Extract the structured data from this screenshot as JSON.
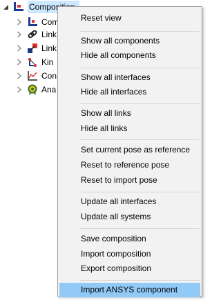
{
  "tree": {
    "root": {
      "label": "Composition",
      "icon": "composition-icon",
      "expanded": true
    },
    "children": [
      {
        "label": "Com",
        "icon": "components-icon"
      },
      {
        "label": "Link",
        "icon": "links-icon"
      },
      {
        "label": "Link",
        "icon": "interfaces-link-icon"
      },
      {
        "label": "Kin",
        "icon": "kinematics-icon"
      },
      {
        "label": "Con",
        "icon": "chart-icon"
      },
      {
        "label": "Ana",
        "icon": "analysis-icon"
      }
    ]
  },
  "context_menu": {
    "groups": [
      [
        {
          "label": "Reset view"
        }
      ],
      [
        {
          "label": "Show all components"
        },
        {
          "label": "Hide all components"
        }
      ],
      [
        {
          "label": "Show all interfaces"
        },
        {
          "label": "Hide all interfaces"
        }
      ],
      [
        {
          "label": "Show all links"
        },
        {
          "label": "Hide all links"
        }
      ],
      [
        {
          "label": "Set current pose as reference"
        },
        {
          "label": "Reset to reference pose"
        },
        {
          "label": "Reset to import pose"
        }
      ],
      [
        {
          "label": "Update all interfaces"
        },
        {
          "label": "Update all systems"
        }
      ],
      [
        {
          "label": "Save composition"
        },
        {
          "label": "Import composition"
        },
        {
          "label": "Export composition"
        }
      ],
      [
        {
          "label": "Import ANSYS component",
          "highlighted": true
        }
      ]
    ]
  },
  "colors": {
    "menu_bg": "#f2f2f2",
    "menu_border": "#a0a0a0",
    "highlight": "#91c9f7",
    "tree_selected": "#cce8ff"
  }
}
